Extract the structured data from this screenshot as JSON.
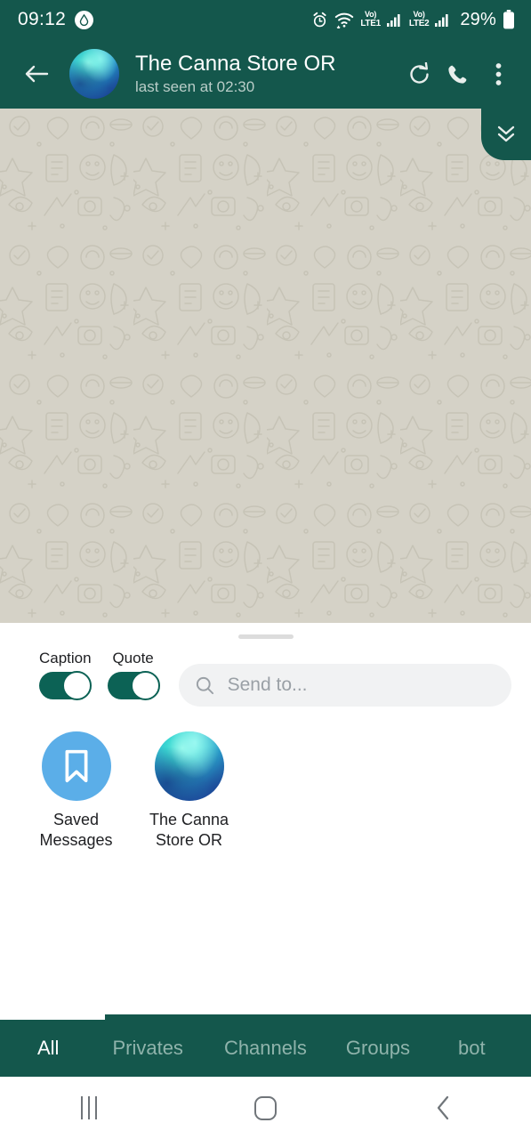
{
  "status_bar": {
    "time": "09:12",
    "app_badge_icon": "water-drop-icon",
    "alarm_icon": "alarm-clock-icon",
    "wifi_icon": "wifi-icon",
    "sim1": {
      "volte_top": "Vo)",
      "volte_bottom": "LTE1",
      "signal_icon": "signal-bars-icon"
    },
    "sim2": {
      "volte_top": "Vo)",
      "volte_bottom": "LTE2",
      "signal_icon": "signal-bars-icon"
    },
    "battery_percent": "29%",
    "battery_icon": "battery-icon"
  },
  "chat_header": {
    "back_icon": "arrow-left-icon",
    "avatar_icon": "contact-avatar",
    "title": "The Canna Store OR",
    "subtitle": "last seen at 02:30",
    "refresh_icon": "refresh-icon",
    "call_icon": "phone-icon",
    "menu_icon": "overflow-menu-icon"
  },
  "chat_area": {
    "scroll_to_bottom_icon": "double-chevron-down-icon"
  },
  "share_sheet": {
    "drag_handle": "drag-handle",
    "toggles": [
      {
        "label": "Caption",
        "on": true
      },
      {
        "label": "Quote",
        "on": true
      }
    ],
    "search": {
      "icon": "search-icon",
      "placeholder": "Send to...",
      "value": ""
    },
    "contacts": [
      {
        "name": "Saved\nMessages",
        "name_line1": "Saved",
        "name_line2": "Messages",
        "avatar": "bookmark-icon"
      },
      {
        "name": "The Canna\nStore OR",
        "name_line1": "The Canna",
        "name_line2": "Store OR",
        "avatar": "contact-photo"
      }
    ]
  },
  "filter_tabs": {
    "items": [
      {
        "label": "All",
        "active": true
      },
      {
        "label": "Privates",
        "active": false
      },
      {
        "label": "Channels",
        "active": false
      },
      {
        "label": "Groups",
        "active": false
      },
      {
        "label": "bot",
        "active": false
      }
    ]
  },
  "nav_bar": {
    "recents_icon": "recents-icon",
    "home_icon": "home-icon",
    "back_icon": "back-chevron-icon"
  },
  "colors": {
    "header_teal": "#14574C",
    "toggle_on": "#0C6255",
    "saved_messages_blue": "#5BAEE8",
    "chat_background": "#d5d2c7",
    "tab_active": "#ffffff",
    "tab_inactive": "#8fb3ab"
  }
}
